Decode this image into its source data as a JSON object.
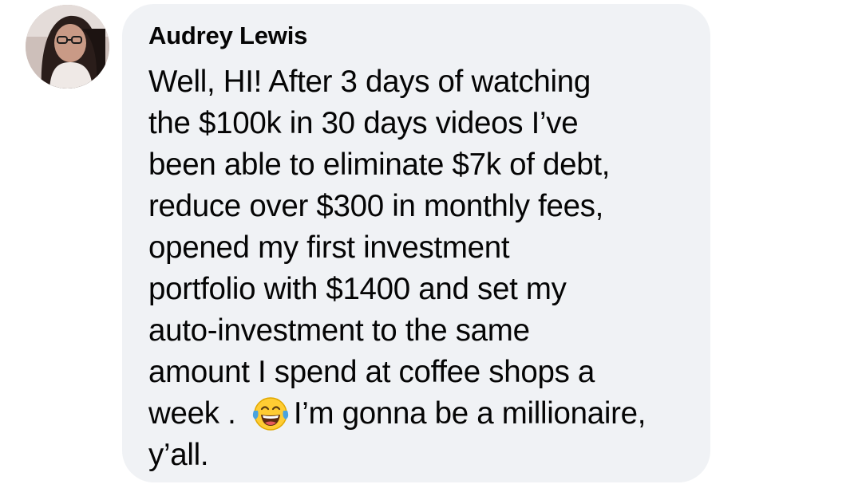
{
  "comment": {
    "author_name": "Audrey Lewis",
    "avatar_icon": "user-avatar-photo",
    "lines": [
      "Well, HI! After 3 days of watching",
      "the $100k in 30 days videos I’ve",
      "been able to eliminate $7k of debt,",
      "reduce over $300 in monthly fees,",
      "opened my first investment",
      "portfolio with $1400 and set my",
      "auto-investment to the same",
      "amount I spend at coffee shops a"
    ],
    "line9_before_emoji": "week . ",
    "emoji_icon": "face-with-tears-of-joy-icon",
    "line9_after_emoji": "I’m gonna be a millionaire,",
    "last_line": "y’all."
  },
  "colors": {
    "bubble_background": "#f0f2f5",
    "text": "#050505",
    "emoji_face": "#ffcc33",
    "emoji_tears": "#4aa3df"
  }
}
